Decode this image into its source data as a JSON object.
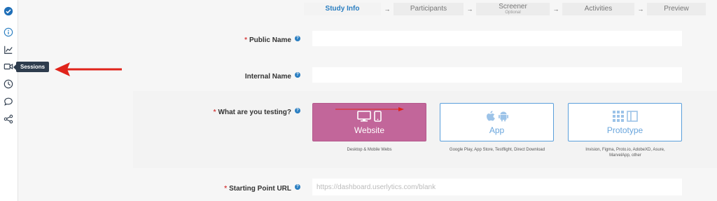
{
  "sidebar": {
    "icons": [
      "logo-check-icon",
      "info-icon",
      "chart-icon",
      "video-icon",
      "clock-icon",
      "chat-icon",
      "share-icon"
    ],
    "tooltip": "Sessions"
  },
  "stepper": {
    "steps": [
      {
        "label": "Study Info",
        "sub": ""
      },
      {
        "label": "Participants",
        "sub": ""
      },
      {
        "label": "Screener",
        "sub": "Optional"
      },
      {
        "label": "Activities",
        "sub": ""
      },
      {
        "label": "Preview",
        "sub": ""
      }
    ],
    "arrow": "→"
  },
  "form": {
    "required_mark": "*",
    "help_glyph": "?",
    "public_name": {
      "label": "Public Name",
      "value": ""
    },
    "internal_name": {
      "label": "Internal Name",
      "value": ""
    },
    "testing": {
      "label": "What are you testing?",
      "options": [
        {
          "label": "Website",
          "caption": "Desktop & Mobile Webs",
          "selected": true
        },
        {
          "label": "App",
          "caption": "Google Play, App Store, Testflight, Direct Download",
          "selected": false
        },
        {
          "label": "Prototype",
          "caption_line1": "Invision, Figma, Proto.io, AdobeXD, Asure,",
          "caption_line2": "MarvelApp, other",
          "selected": false
        }
      ]
    },
    "starting_url": {
      "label": "Starting Point URL",
      "placeholder": "https://dashboard.userlytics.com/blank"
    }
  },
  "colors": {
    "accent": "#2a7ec1",
    "selected_tile": "#c2669a",
    "option_border": "#5a9fdb",
    "annotation_arrow": "#e0241b"
  }
}
